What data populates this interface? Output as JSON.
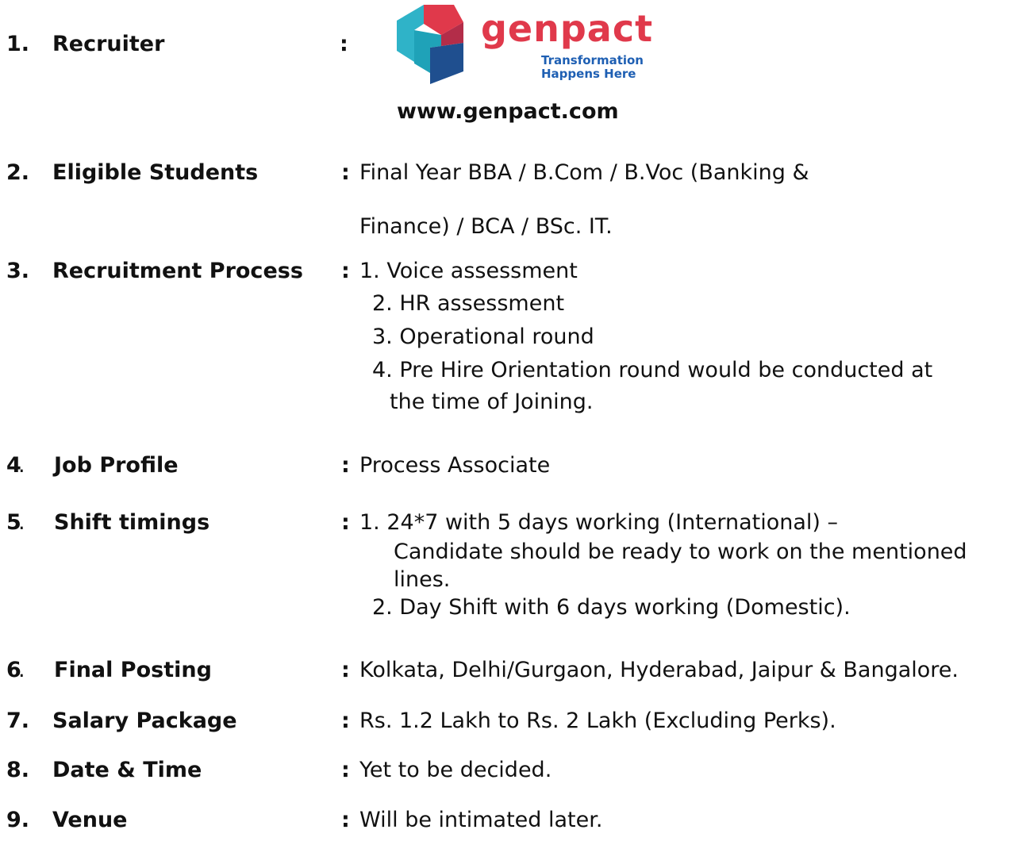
{
  "recruiter": {
    "num": "1.",
    "label": "Recruiter",
    "colon": ":",
    "logo_word": "genpact",
    "logo_tag1": "Transformation",
    "logo_tag2": "Happens Here",
    "website": "www.genpact.com",
    "colors": {
      "brand_red": "#e0394b",
      "brand_blue": "#1f4f8f",
      "brand_teal": "#2fb3c8",
      "tag_blue": "#1e5fb3"
    }
  },
  "eligible": {
    "num": "2.",
    "label": "Eligible Students",
    "colon": ":",
    "line1": "Final Year BBA / B.Com / B.Voc (Banking &",
    "line2": "Finance) / BCA / BSc. IT."
  },
  "process": {
    "num": "3.",
    "label": "Recruitment Process",
    "colon": ":",
    "step1": "1. Voice assessment",
    "step2": "2. HR assessment",
    "step3": "3. Operational round",
    "step4a": "4. Pre Hire Orientation round would be conducted at",
    "step4b": "the time of Joining."
  },
  "profile": {
    "num": "4",
    "dot": ".",
    "label": "Job Profile",
    "colon": ":",
    "value": "Process Associate"
  },
  "shift": {
    "num": "5",
    "dot": ".",
    "label": "Shift timings",
    "colon": ":",
    "l1": "1. 24*7 with 5 days working (International) –",
    "l2": "Candidate should be ready to work on the mentioned",
    "l3": "lines.",
    "l4": "2. Day Shift with 6 days working (Domestic)."
  },
  "posting": {
    "num": "6",
    "dot": ".",
    "label": "Final Posting",
    "colon": ":",
    "value": "Kolkata, Delhi/Gurgaon, Hyderabad, Jaipur & Bangalore."
  },
  "salary": {
    "num": "7.",
    "label": "Salary Package",
    "colon": ":",
    "value": "Rs. 1.2 Lakh to Rs. 2 Lakh (Excluding Perks)."
  },
  "datetime": {
    "num": "8.",
    "label": "Date & Time",
    "colon": ":",
    "value": "Yet to be decided."
  },
  "venue": {
    "num": "9.",
    "label": "Venue",
    "colon": ":",
    "value": "Will be intimated later."
  }
}
